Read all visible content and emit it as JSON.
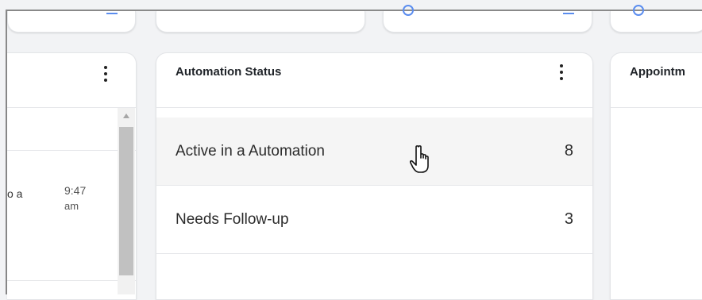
{
  "left_card": {
    "row_text": "o a",
    "row_time_line1": "9:47",
    "row_time_line2": "am"
  },
  "automation_card": {
    "title": "Automation Status",
    "rows": [
      {
        "label": "Active in a Automation",
        "count": "8"
      },
      {
        "label": "Needs Follow-up",
        "count": "3"
      }
    ]
  },
  "appointments_card": {
    "title": "Appointm"
  },
  "colors": {
    "accent": "#5b8def",
    "hover_row": "#f5f5f5"
  },
  "icons": [
    "arrow-right-icon",
    "circle-icon",
    "kebab-menu-icon",
    "hand-pointer-cursor-icon"
  ]
}
